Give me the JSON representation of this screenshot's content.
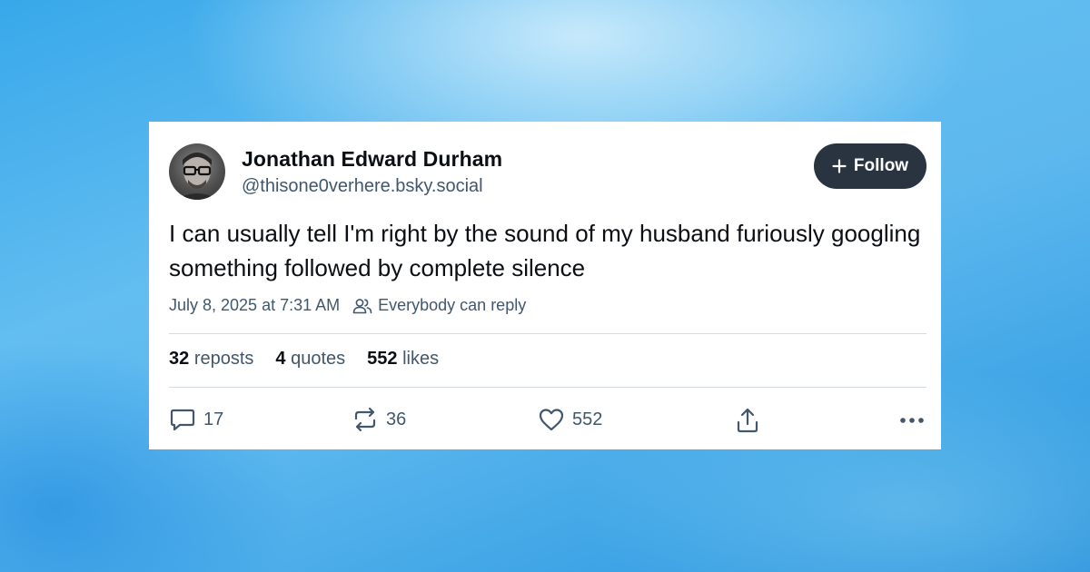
{
  "author": {
    "name": "Jonathan Edward Durham",
    "handle": "@thisone0verhere.bsky.social"
  },
  "follow_button": {
    "label": "Follow",
    "icon": "plus-icon"
  },
  "post": {
    "text": "I can usually tell I'm right by the sound of my husband furiously googling something followed by complete silence",
    "timestamp": "July 8, 2025 at 7:31 AM",
    "reply_setting": "Everybody can reply"
  },
  "stats": {
    "reposts_count": "32",
    "reposts_label": "reposts",
    "quotes_count": "4",
    "quotes_label": "quotes",
    "likes_count": "552",
    "likes_label": "likes"
  },
  "actions": {
    "reply_count": "17",
    "repost_count": "36",
    "like_count": "552"
  },
  "colors": {
    "background": "#4fb3ec",
    "card": "#ffffff",
    "follow_button": "#2a3441",
    "text_primary": "#0b0f14",
    "text_secondary": "#42576c"
  }
}
